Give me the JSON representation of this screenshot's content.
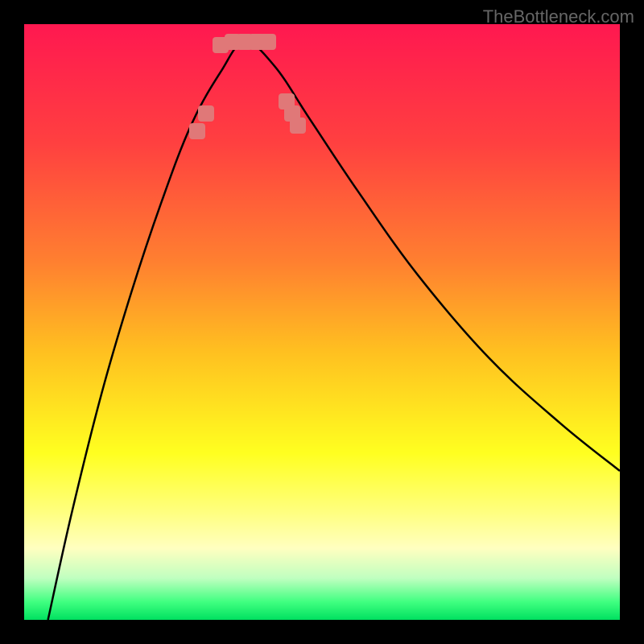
{
  "watermark": "TheBottleneck.com",
  "chart_data": {
    "type": "line",
    "title": "",
    "xlabel": "",
    "ylabel": "",
    "x_range": [
      0,
      100
    ],
    "y_range": [
      0,
      100
    ],
    "gradient_stops": [
      {
        "position": 0,
        "color": "#ff1850"
      },
      {
        "position": 20,
        "color": "#ff4040"
      },
      {
        "position": 40,
        "color": "#ff8030"
      },
      {
        "position": 55,
        "color": "#ffc020"
      },
      {
        "position": 72,
        "color": "#ffff20"
      },
      {
        "position": 82,
        "color": "#ffff80"
      },
      {
        "position": 88,
        "color": "#ffffc0"
      },
      {
        "position": 93,
        "color": "#c0ffc0"
      },
      {
        "position": 97,
        "color": "#40ff80"
      },
      {
        "position": 100,
        "color": "#00e060"
      }
    ],
    "curve": {
      "description": "V-shaped bottleneck curve with minimum near x=37",
      "left_branch_points": [
        {
          "x": 4,
          "y": 0
        },
        {
          "x": 8,
          "y": 18
        },
        {
          "x": 13,
          "y": 38
        },
        {
          "x": 18,
          "y": 55
        },
        {
          "x": 23,
          "y": 70
        },
        {
          "x": 28,
          "y": 83
        },
        {
          "x": 33,
          "y": 92
        },
        {
          "x": 37,
          "y": 97
        }
      ],
      "right_branch_points": [
        {
          "x": 37,
          "y": 97
        },
        {
          "x": 42,
          "y": 93
        },
        {
          "x": 48,
          "y": 84
        },
        {
          "x": 56,
          "y": 72
        },
        {
          "x": 66,
          "y": 58
        },
        {
          "x": 78,
          "y": 44
        },
        {
          "x": 90,
          "y": 33
        },
        {
          "x": 100,
          "y": 25
        }
      ]
    },
    "highlighted_points": [
      {
        "x": 29,
        "y": 82
      },
      {
        "x": 30.5,
        "y": 85
      },
      {
        "x": 33,
        "y": 96.5
      },
      {
        "x": 35,
        "y": 97
      },
      {
        "x": 37,
        "y": 97
      },
      {
        "x": 39,
        "y": 97
      },
      {
        "x": 41,
        "y": 97
      },
      {
        "x": 44,
        "y": 87
      },
      {
        "x": 45,
        "y": 85
      },
      {
        "x": 46,
        "y": 83
      }
    ]
  }
}
